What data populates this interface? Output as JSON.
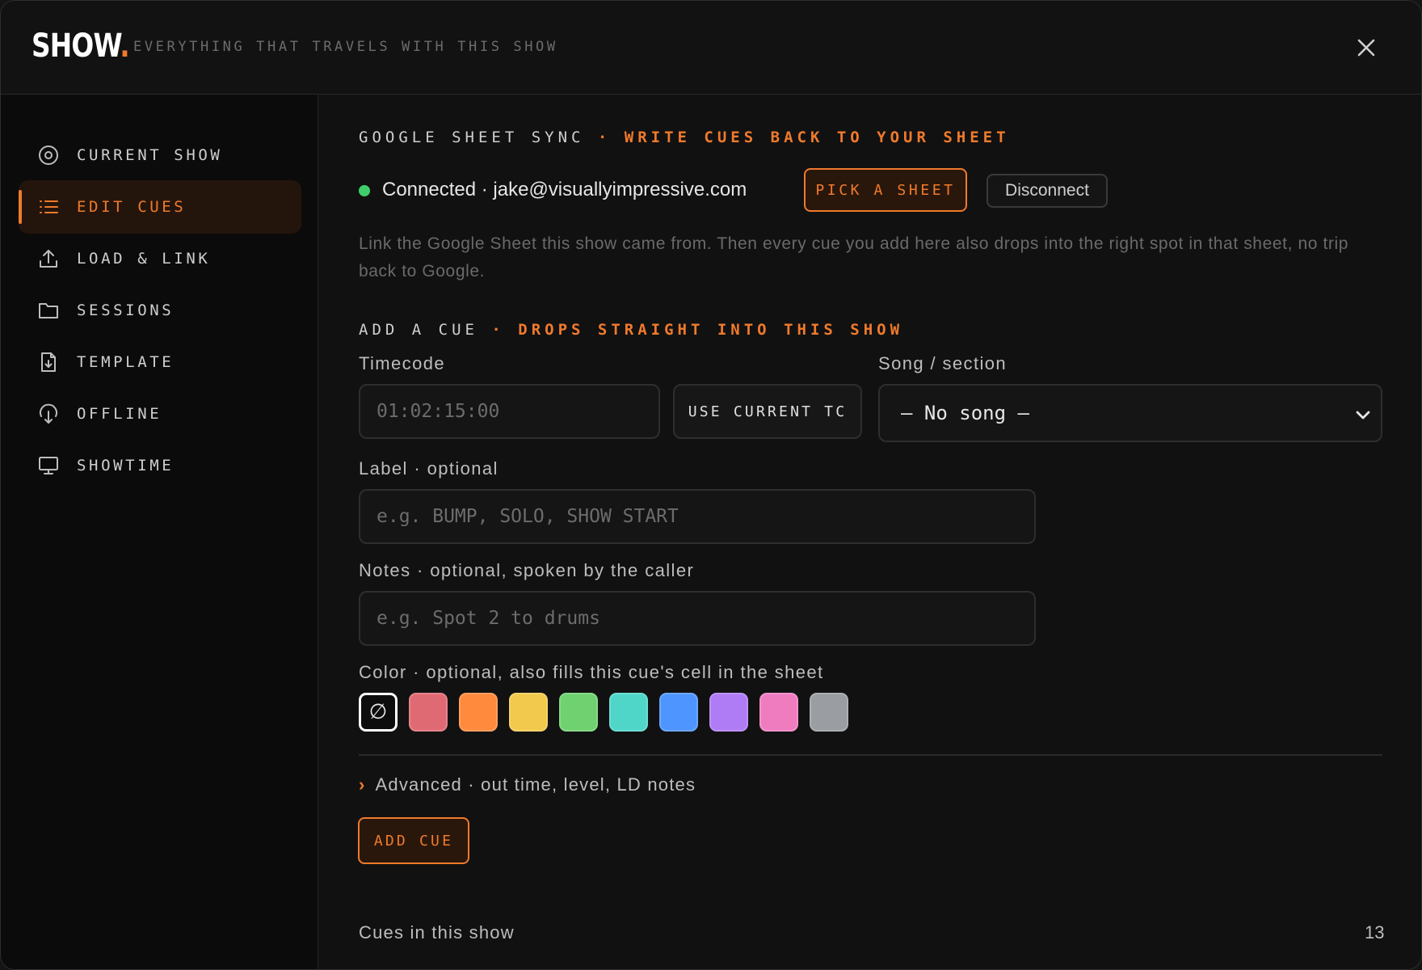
{
  "app": {
    "logo": "SHOW",
    "logo_dot": ".",
    "tagline": "EVERYTHING THAT TRAVELS WITH THIS SHOW",
    "close_icon": "close-icon"
  },
  "sidebar": {
    "items": [
      {
        "label": "CURRENT SHOW",
        "icon": "target-icon",
        "active": false
      },
      {
        "label": "EDIT CUES",
        "icon": "list-icon",
        "active": true
      },
      {
        "label": "LOAD & LINK",
        "icon": "upload-icon",
        "active": false
      },
      {
        "label": "SESSIONS",
        "icon": "folder-icon",
        "active": false
      },
      {
        "label": "TEMPLATE",
        "icon": "file-download-icon",
        "active": false
      },
      {
        "label": "OFFLINE",
        "icon": "offline-download-icon",
        "active": false
      },
      {
        "label": "SHOWTIME",
        "icon": "monitor-icon",
        "active": false
      }
    ]
  },
  "sync": {
    "heading": "GOOGLE SHEET SYNC",
    "heading_accent": "· WRITE CUES BACK TO YOUR SHEET",
    "status": "Connected · jake@visuallyimpressive.com",
    "status_color": "#3fcf6a",
    "pick_label": "PICK A SHEET",
    "disconnect_label": "Disconnect",
    "description": "Link the Google Sheet this show came from. Then every cue you add here also drops into the right spot in that sheet, no trip back to Google."
  },
  "add_cue": {
    "heading": "ADD A CUE",
    "heading_accent": "· DROPS STRAIGHT INTO THIS SHOW",
    "timecode_label": "Timecode",
    "timecode_placeholder": "01:02:15:00",
    "use_current_label": "USE CURRENT TC",
    "song_label": "Song / section",
    "song_value": "— No song —",
    "label_label": "Label · optional",
    "label_placeholder": "e.g. BUMP, SOLO, SHOW START",
    "notes_label": "Notes · optional, spoken by the caller",
    "notes_placeholder": "e.g. Spot 2 to drums",
    "color_label": "Color · optional, also fills this cue's cell in the sheet",
    "none_symbol": "∅",
    "colors": [
      "#e06a73",
      "#ff8a3d",
      "#f2c94c",
      "#6fd16f",
      "#4fd6c8",
      "#4f95ff",
      "#b07cf5",
      "#f07cc0",
      "#9a9ea3"
    ],
    "advanced_caret": "›",
    "advanced_label": "Advanced · out time, level, LD notes",
    "add_label": "ADD CUE"
  },
  "cues": {
    "label": "Cues in this show",
    "count": "13"
  },
  "accent_color": "#f07a2c"
}
